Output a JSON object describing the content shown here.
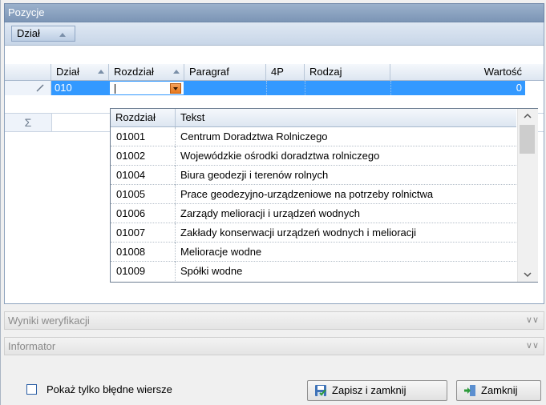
{
  "window": {
    "title": "Pozycje"
  },
  "group_panel": {
    "chip_label": "Dział"
  },
  "grid": {
    "columns": [
      "Dział",
      "Rozdział",
      "Paragraf",
      "4P",
      "Rodzaj",
      "Wartość"
    ],
    "rows": [
      {
        "dzial": "010",
        "rozdzial": "",
        "wartosc": "0"
      }
    ],
    "sum_symbol": "Σ"
  },
  "dropdown": {
    "columns": [
      "Rozdział",
      "Tekst"
    ],
    "rows": [
      {
        "code": "01001",
        "text": "Centrum Doradztwa Rolniczego"
      },
      {
        "code": "01002",
        "text": "Wojewódzkie ośrodki doradztwa rolniczego"
      },
      {
        "code": "01004",
        "text": "Biura geodezji i terenów rolnych"
      },
      {
        "code": "01005",
        "text": "Prace geodezyjno-urządzeniowe na potrzeby rolnictwa"
      },
      {
        "code": "01006",
        "text": "Zarządy melioracji i urządzeń wodnych"
      },
      {
        "code": "01007",
        "text": "Zakłady konserwacji urządzeń wodnych i melioracji"
      },
      {
        "code": "01008",
        "text": "Melioracje wodne"
      },
      {
        "code": "01009",
        "text": "Spółki wodne"
      }
    ]
  },
  "sections": {
    "verification": "Wyniki weryfikacji",
    "informator": "Informator"
  },
  "footer": {
    "checkbox_label": "Pokaż tylko błędne wiersze",
    "save_close": "Zapisz i zamknij",
    "close": "Zamknij"
  },
  "colors": {
    "selection": "#3399ff",
    "title_bg": "#7c95b6",
    "accent_orange": "#e8781c"
  },
  "icons": [
    "edit-pencil-icon",
    "dropdown-arrow-icon",
    "sort-asc-icon",
    "sigma-icon",
    "chevron-double-down-icon",
    "save-disk-icon",
    "exit-door-icon"
  ]
}
